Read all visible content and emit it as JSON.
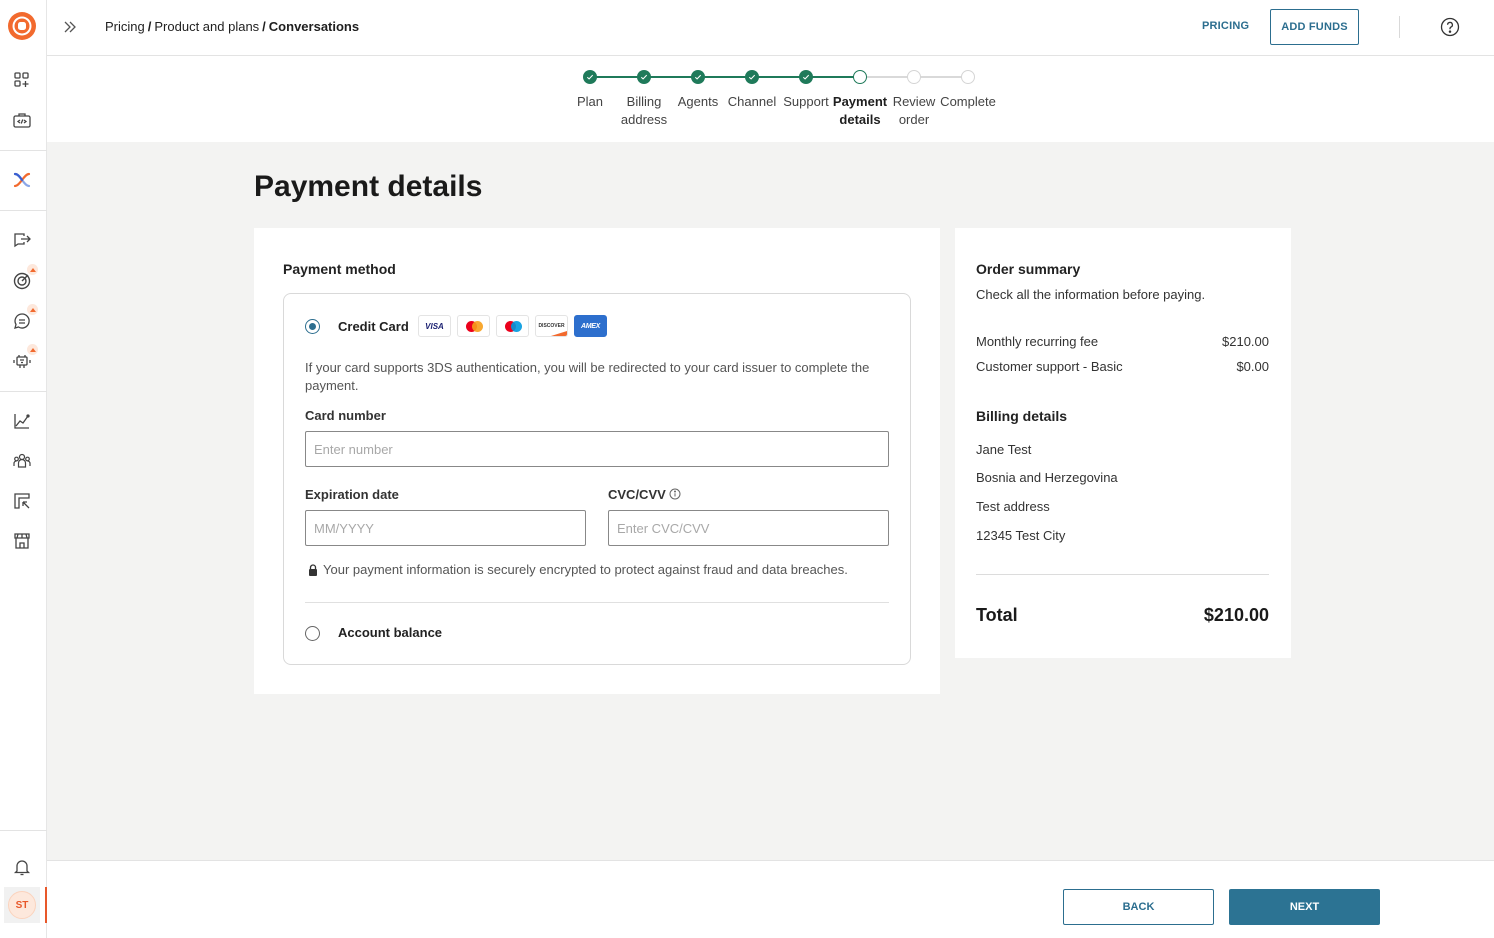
{
  "header": {
    "breadcrumb": [
      "Pricing",
      "Product and plans",
      "Conversations"
    ],
    "pricing_link": "PRICING",
    "add_funds_label": "ADD FUNDS"
  },
  "sidebar": {
    "items": [
      {
        "icon": "apps-add-icon"
      },
      {
        "icon": "code-toolbox-icon"
      },
      {
        "icon": "brand-x-icon"
      },
      {
        "icon": "export-chat-icon"
      },
      {
        "icon": "target-icon",
        "badge": "upgrade"
      },
      {
        "icon": "chat-bubble-icon",
        "badge": "upgrade"
      },
      {
        "icon": "bot-icon",
        "badge": "upgrade"
      },
      {
        "icon": "analytics-chart-icon"
      },
      {
        "icon": "people-icon"
      },
      {
        "icon": "frame-cursor-icon"
      },
      {
        "icon": "store-icon"
      },
      {
        "icon": "bell-icon"
      }
    ],
    "avatar_initials": "ST"
  },
  "stepper": {
    "steps": [
      {
        "label": "Plan",
        "status": "done"
      },
      {
        "label": "Billing\naddress",
        "status": "done"
      },
      {
        "label": "Agents",
        "status": "done"
      },
      {
        "label": "Channel",
        "status": "done"
      },
      {
        "label": "Support",
        "status": "done"
      },
      {
        "label": "Payment\ndetails",
        "status": "active"
      },
      {
        "label": "Review\norder",
        "status": "todo"
      },
      {
        "label": "Complete",
        "status": "todo"
      }
    ]
  },
  "page": {
    "title": "Payment details"
  },
  "payment": {
    "section_title": "Payment method",
    "credit_card_label": "Credit Card",
    "credit_card_selected": true,
    "card_brands": [
      "VISA",
      "Mastercard",
      "Maestro",
      "DISCOVER",
      "AMEX"
    ],
    "info_text": "If your card supports 3DS authentication, you will be redirected to your card issuer to complete the payment.",
    "card_number_label": "Card number",
    "card_number_placeholder": "Enter number",
    "card_number_value": "",
    "expiration_label": "Expiration date",
    "expiration_placeholder": "MM/YYYY",
    "expiration_value": "",
    "cvc_label": "CVC/CVV",
    "cvc_placeholder": "Enter CVC/CVV",
    "cvc_value": "",
    "secure_note": "Your payment information is securely encrypted to protect against fraud and data breaches.",
    "account_balance_label": "Account balance",
    "account_balance_selected": false
  },
  "order_summary": {
    "title": "Order summary",
    "subtitle": "Check all the information before paying.",
    "items": [
      {
        "label": "Monthly recurring fee",
        "amount": "$210.00"
      },
      {
        "label": "Customer support - Basic",
        "amount": "$0.00"
      }
    ],
    "billing_title": "Billing details",
    "billing_lines": [
      "Jane Test",
      "Bosnia and Herzegovina",
      "Test address",
      "12345 Test City"
    ],
    "total_label": "Total",
    "total_amount": "$210.00"
  },
  "footer": {
    "back_label": "BACK",
    "next_label": "NEXT"
  },
  "colors": {
    "brand_orange": "#f26a2e",
    "primary": "#2c7393",
    "step_done": "#1f7a5a"
  }
}
